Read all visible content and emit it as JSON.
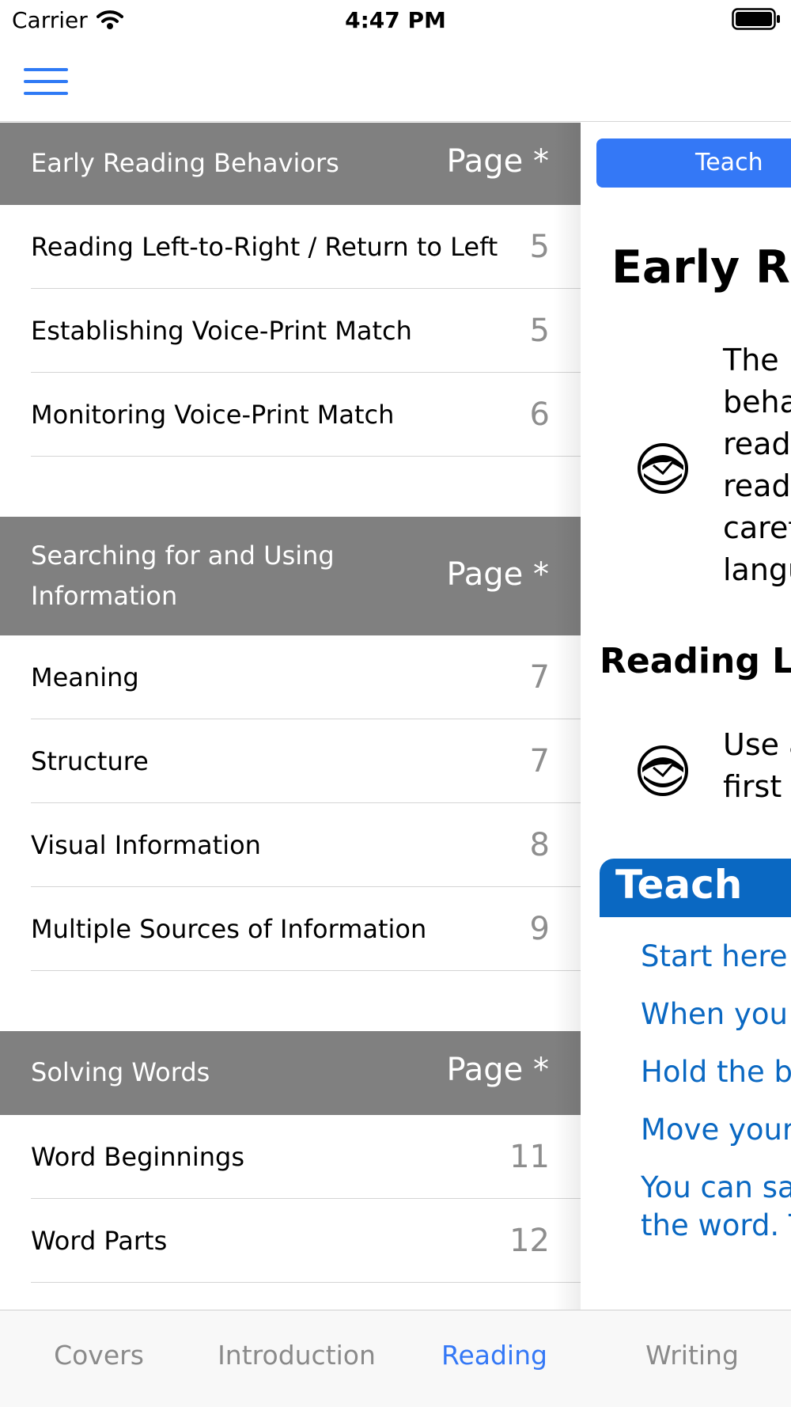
{
  "status_bar": {
    "carrier": "Carrier",
    "time": "4:47 PM"
  },
  "nav": {
    "menu_icon": "hamburger-menu-icon"
  },
  "sections": [
    {
      "title": "Early Reading Behaviors",
      "page_label": "Page *",
      "rows": [
        {
          "title": "Reading Left-to-Right / Return to Left",
          "page": "5"
        },
        {
          "title": "Establishing Voice-Print Match",
          "page": "5"
        },
        {
          "title": "Monitoring Voice-Print Match",
          "page": "6"
        }
      ]
    },
    {
      "title_line1": "Searching for and Using",
      "title_line2": "Information",
      "page_label": "Page *",
      "rows": [
        {
          "title": "Meaning",
          "page": "7"
        },
        {
          "title": "Structure",
          "page": "7"
        },
        {
          "title": "Visual Information",
          "page": "8"
        },
        {
          "title": "Multiple Sources of Information",
          "page": "9"
        }
      ]
    },
    {
      "title": "Solving Words",
      "page_label": "Page *",
      "rows": [
        {
          "title": "Word Beginnings",
          "page": "11"
        },
        {
          "title": "Word Parts",
          "page": "12"
        }
      ]
    }
  ],
  "content": {
    "tab_label": "Teach",
    "title": "Early Re",
    "intro_lines": [
      "The",
      "beha",
      "read",
      "readi",
      "caref",
      "langu"
    ],
    "subheading": "Reading Let",
    "sub_lines": [
      "Use a",
      "first a"
    ],
    "teach_heading": "Teach",
    "teach_items": [
      "Start here a",
      "When you f",
      "Hold the bo",
      "Move your",
      "You can sav",
      "the word. T"
    ],
    "colors": {
      "tab_blue": "#3478f6",
      "teach_blue": "#0a68c2"
    }
  },
  "tabs": [
    {
      "label": "Covers"
    },
    {
      "label": "Introduction"
    },
    {
      "label": "Reading",
      "active": true
    },
    {
      "label": "Writing"
    }
  ]
}
